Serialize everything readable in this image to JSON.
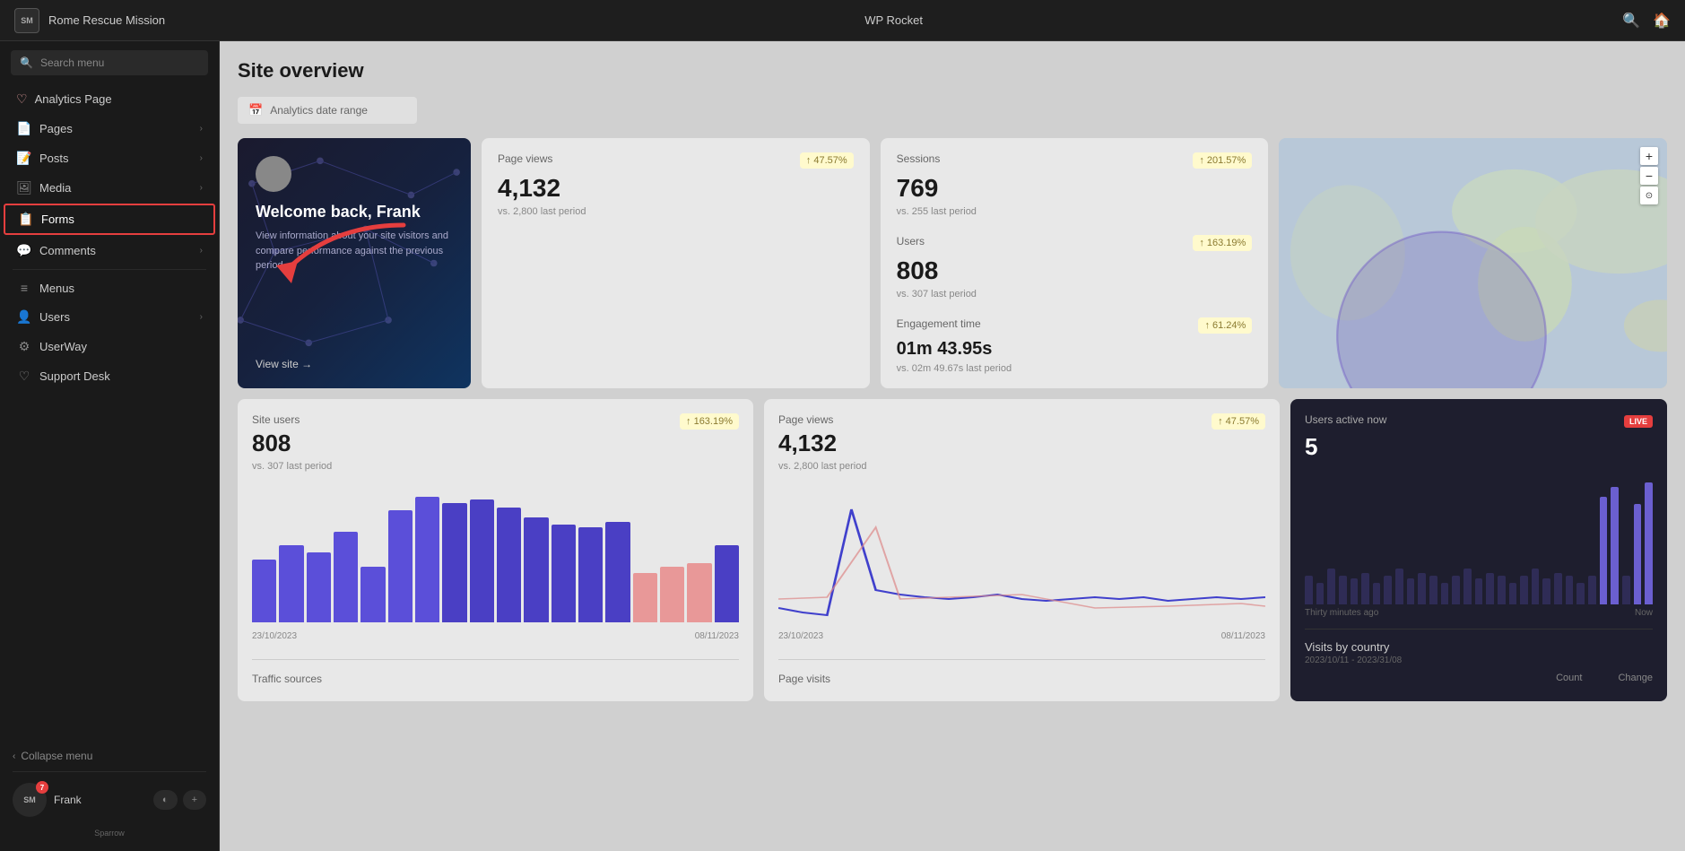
{
  "topbar": {
    "logo_text": "SM",
    "site_name": "Rome Rescue Mission",
    "plugin_name": "WP Rocket",
    "search_icon": "🔍",
    "home_icon": "🏠"
  },
  "sidebar": {
    "search_placeholder": "Search menu",
    "items": [
      {
        "id": "analytics",
        "label": "Analytics Page",
        "icon": "♡",
        "has_arrow": false
      },
      {
        "id": "pages",
        "label": "Pages",
        "icon": "📄",
        "has_arrow": true
      },
      {
        "id": "posts",
        "label": "Posts",
        "icon": "📝",
        "has_arrow": true
      },
      {
        "id": "media",
        "label": "Media",
        "icon": "🖼",
        "has_arrow": true
      },
      {
        "id": "forms",
        "label": "Forms",
        "icon": "📋",
        "has_arrow": false,
        "active": true
      },
      {
        "id": "comments",
        "label": "Comments",
        "icon": "💬",
        "has_arrow": true
      },
      {
        "id": "menus",
        "label": "Menus",
        "icon": "≡",
        "has_arrow": false
      },
      {
        "id": "users",
        "label": "Users",
        "icon": "👤",
        "has_arrow": true
      },
      {
        "id": "userway",
        "label": "UserWay",
        "icon": "⚙",
        "has_arrow": false
      },
      {
        "id": "support",
        "label": "Support Desk",
        "icon": "♡",
        "has_arrow": false
      }
    ],
    "collapse_label": "Collapse menu",
    "user_name": "Frank",
    "user_badge": "SM",
    "notification_count": "7",
    "sparrow_label": "Sparrow"
  },
  "main": {
    "page_title": "Site overview",
    "date_range_label": "Analytics date range",
    "welcome": {
      "avatar_text": "",
      "title": "Welcome back, Frank",
      "description": "View information about your site visitors and compare performance against the previous period.",
      "view_site": "View site →"
    },
    "stats": {
      "page_views": {
        "label": "Page views",
        "value": "4,132",
        "badge": "↑ 47.57%",
        "vs": "vs. 2,800 last period"
      },
      "sessions": {
        "label": "Sessions",
        "value": "769",
        "badge": "↑ 201.57%",
        "vs": "vs. 255 last period"
      },
      "users": {
        "label": "Users",
        "value": "808",
        "badge": "↑ 163.19%",
        "vs": "vs. 307 last period"
      },
      "engagement": {
        "label": "Engagement time",
        "value": "01m 43.95s",
        "badge": "↑ 61.24%",
        "vs": "vs. 02m 49.67s last period"
      }
    },
    "site_users_chart": {
      "title": "Site users",
      "value": "808",
      "badge": "↑ 163.19%",
      "vs": "vs. 307 last period",
      "date_from": "23/10/2023",
      "date_to": "08/11/2023"
    },
    "page_views_chart": {
      "title": "Page views",
      "value": "4,132",
      "badge": "↑ 47.57%",
      "vs": "vs. 2,800 last period",
      "date_from": "23/10/2023",
      "date_to": "08/11/2023"
    },
    "active_now": {
      "title": "Users active now",
      "value": "5",
      "live_label": "LIVE",
      "time_label_left": "Thirty minutes ago",
      "time_label_right": "Now"
    },
    "visits_by_country": {
      "title": "Visits by country",
      "date_range": "2023/10/11 - 2023/31/08",
      "col_count": "Count",
      "col_change": "Change"
    },
    "traffic_sources": {
      "title": "Traffic sources"
    },
    "page_visits": {
      "title": "Page visits"
    }
  }
}
